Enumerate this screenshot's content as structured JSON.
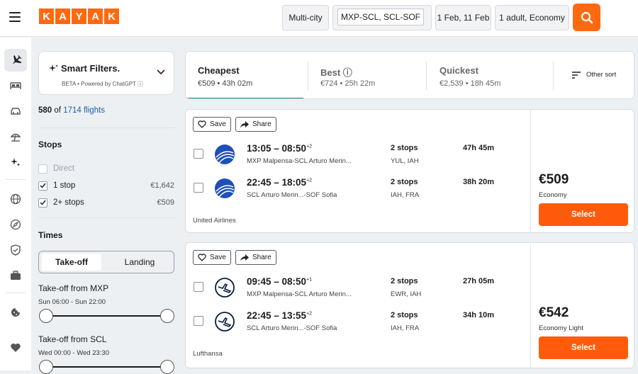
{
  "header": {
    "logo_letters": [
      "K",
      "A",
      "Y",
      "A",
      "K"
    ],
    "trip_type": "Multi-city",
    "route": "MXP-SCL, SCL-SOF",
    "dates": "1 Feb, 11 Feb",
    "travellers": "1 adult, Economy"
  },
  "filters": {
    "smart_title": "Smart Filters.",
    "smart_sub": "BETA • Powered by ChatGPT ⓘ",
    "count_shown": "580",
    "count_of": "of",
    "count_total": "1714 flights",
    "stops_title": "Stops",
    "stops": [
      {
        "label": "Direct",
        "price": "",
        "checked": false,
        "disabled": true
      },
      {
        "label": "1 stop",
        "price": "€1,642",
        "checked": true,
        "disabled": false
      },
      {
        "label": "2+ stops",
        "price": "€509",
        "checked": true,
        "disabled": false
      }
    ],
    "times_title": "Times",
    "times_tabs": [
      "Take-off",
      "Landing"
    ],
    "takeoff_mxp_title": "Take-off from MXP",
    "takeoff_mxp_range": "Sun 06:00 - Sun 22:00",
    "takeoff_scl_title": "Take-off from SCL",
    "takeoff_scl_range": "Wed 00:00 - Wed 23:30"
  },
  "sort": {
    "tabs": [
      {
        "title": "Cheapest",
        "sub": "€509 • 43h 02m"
      },
      {
        "title": "Best ⓘ",
        "sub": "€724 • 25h 22m"
      },
      {
        "title": "Quickest",
        "sub": "€2,539 • 18h 45m"
      }
    ],
    "other": "Other sort"
  },
  "actions": {
    "save": "Save",
    "share": "Share",
    "select": "Select"
  },
  "results": [
    {
      "carrier": "United Airlines",
      "price": "€509",
      "fare": "Economy",
      "segments": [
        {
          "times": "13:05 – 08:50",
          "plus": "+2",
          "route": "MXP Malpensa-SCL Arturo Merin...",
          "stops": "2 stops",
          "via": "YUL, IAH",
          "duration": "47h 45m"
        },
        {
          "times": "22:45 – 18:05",
          "plus": "+2",
          "route": "SCL Arturo Merin...-SOF Sofia",
          "stops": "2 stops",
          "via": "IAH, FRA",
          "duration": "38h 20m"
        }
      ]
    },
    {
      "carrier": "Lufthansa",
      "price": "€542",
      "fare": "Economy Light",
      "segments": [
        {
          "times": "09:45 – 08:50",
          "plus": "+1",
          "route": "MXP Malpensa-SCL Arturo Merin...",
          "stops": "2 stops",
          "via": "EWR, IAH",
          "duration": "27h 05m"
        },
        {
          "times": "22:45 – 13:55",
          "plus": "+2",
          "route": "SCL Arturo Merin...-SOF Sofia",
          "stops": "2 stops",
          "via": "IAH, FRA",
          "duration": "34h 10m"
        }
      ]
    }
  ]
}
